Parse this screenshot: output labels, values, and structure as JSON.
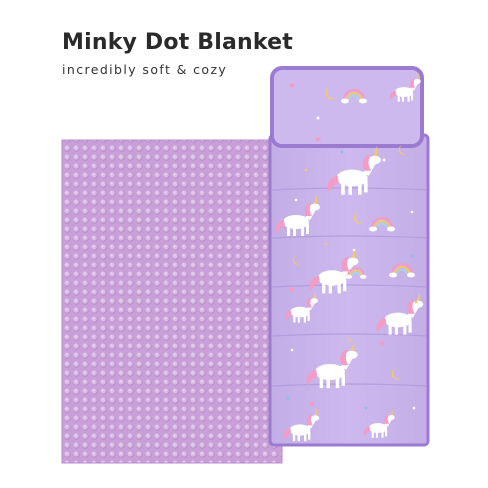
{
  "header": {
    "title": "Minky Dot Blanket",
    "subtitle": "incredibly soft & cozy"
  },
  "product": {
    "colors": {
      "blanket": "#c99fd8",
      "blanket_dot_light": "#dcc0e7",
      "blanket_dot_shadow": "#b689c8",
      "mat_fabric": "#cbb7ec",
      "mat_piping": "#9b7bd1",
      "mat_quilt_line": "#b49ddd",
      "unicorn_mane": "#f29cc6",
      "moon": "#f4c86a"
    },
    "mat_panel_count": 6
  }
}
